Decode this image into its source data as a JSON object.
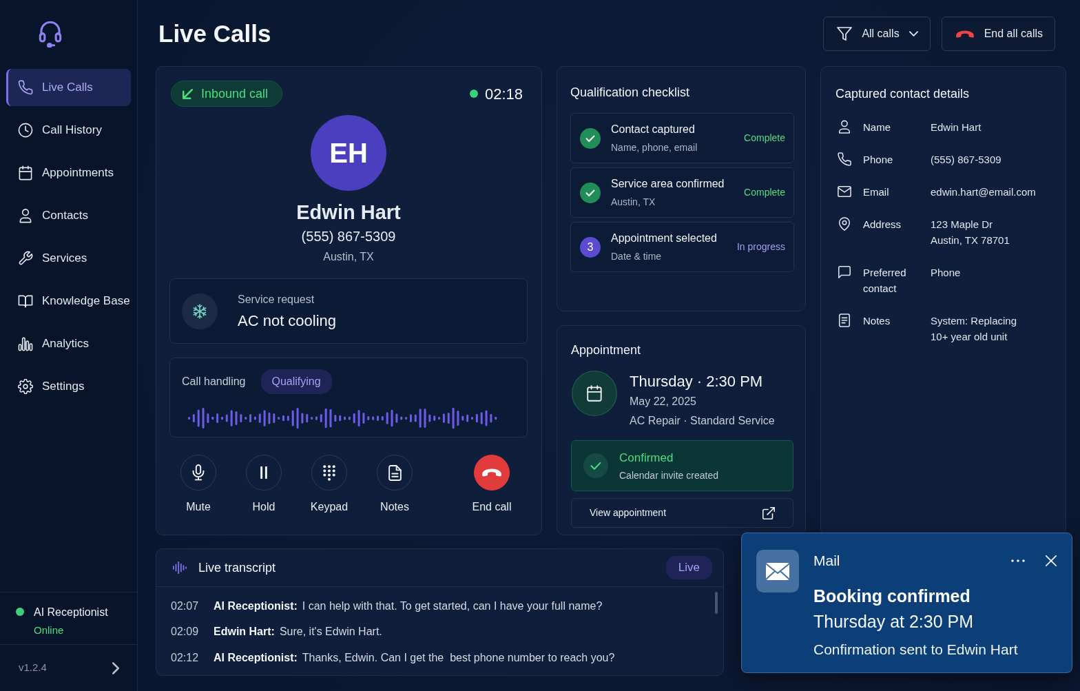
{
  "sidebar": {
    "items": [
      {
        "label": "Live Calls",
        "selected": true
      },
      {
        "label": "Call History",
        "selected": false
      },
      {
        "label": "Appointments",
        "selected": false
      },
      {
        "label": "Contacts",
        "selected": false
      },
      {
        "label": "Services",
        "selected": false
      },
      {
        "label": "Knowledge Base",
        "selected": false
      },
      {
        "label": "Analytics",
        "selected": false
      },
      {
        "label": "Settings",
        "selected": false
      }
    ],
    "agent": {
      "name": "AI Receptionist",
      "status": "Online",
      "online": true
    },
    "version": "v1.2.4"
  },
  "header": {
    "title": "Live Calls",
    "filter": "All calls",
    "end_all": "End all calls"
  },
  "call": {
    "direction": "Inbound call",
    "timer": "02:18",
    "initials": "EH",
    "name": "Edwin Hart",
    "phone": "(555) 867-5309",
    "location": "Austin, TX",
    "service_request": {
      "label": "Service request",
      "value": "AC not cooling"
    },
    "handling": {
      "label": "Call handling",
      "stage": "Qualifying"
    },
    "controls": [
      {
        "label": "Mute",
        "kind": "default"
      },
      {
        "label": "Hold",
        "kind": "default"
      },
      {
        "label": "Keypad",
        "kind": "default"
      },
      {
        "label": "Notes",
        "kind": "default"
      },
      {
        "label": "End call",
        "kind": "danger"
      }
    ]
  },
  "checklist": {
    "title": "Qualification checklist",
    "items": [
      {
        "title": "Contact captured",
        "detail": "Name, phone, email",
        "status": "Complete",
        "kind": "done"
      },
      {
        "title": "Service area confirmed",
        "detail": "Austin, TX",
        "status": "Complete",
        "kind": "done"
      },
      {
        "title": "Appointment selected",
        "detail": "Date & time",
        "status": "In progress",
        "kind": "step",
        "step": "3"
      }
    ]
  },
  "appointment": {
    "title": "Appointment",
    "when": "Thursday · 2:30 PM",
    "date": "May 22, 2025",
    "service": "AC Repair · Standard Service",
    "confirmation": {
      "title": "Confirmed",
      "detail": "Calendar invite created"
    },
    "link": "View appointment"
  },
  "contact_details": {
    "title": "Captured contact details",
    "fields": [
      {
        "label": "Name",
        "lines": [
          "Edwin Hart"
        ]
      },
      {
        "label": "Phone",
        "lines": [
          "(555) 867-5309"
        ]
      },
      {
        "label": "Email",
        "lines": [
          "edwin.hart@email.com"
        ]
      },
      {
        "label": "Address",
        "lines": [
          "123 Maple Dr",
          "Austin, TX 78701"
        ]
      },
      {
        "label": "Preferred contact",
        "lines": [
          "Phone"
        ]
      },
      {
        "label": "Notes",
        "lines": [
          "System: Replacing",
          "10+ year old unit"
        ]
      }
    ]
  },
  "transcript": {
    "title": "Live transcript",
    "badge": "Live",
    "lines": [
      {
        "time": "02:07",
        "speaker": "AI Receptionist:",
        "text": "I can help with that. To get started, can I have your full name?"
      },
      {
        "time": "02:09",
        "speaker": "Edwin Hart:",
        "text": "Sure, it's Edwin Hart."
      },
      {
        "time": "02:12",
        "speaker": "AI Receptionist:",
        "text": "Thanks, Edwin. Can I get the  best phone number to reach you?"
      }
    ]
  },
  "notification": {
    "app": "Mail",
    "title": "Booking confirmed",
    "time": "Thursday at 2:30 PM",
    "message": "Confirmation sent to Edwin Hart"
  }
}
